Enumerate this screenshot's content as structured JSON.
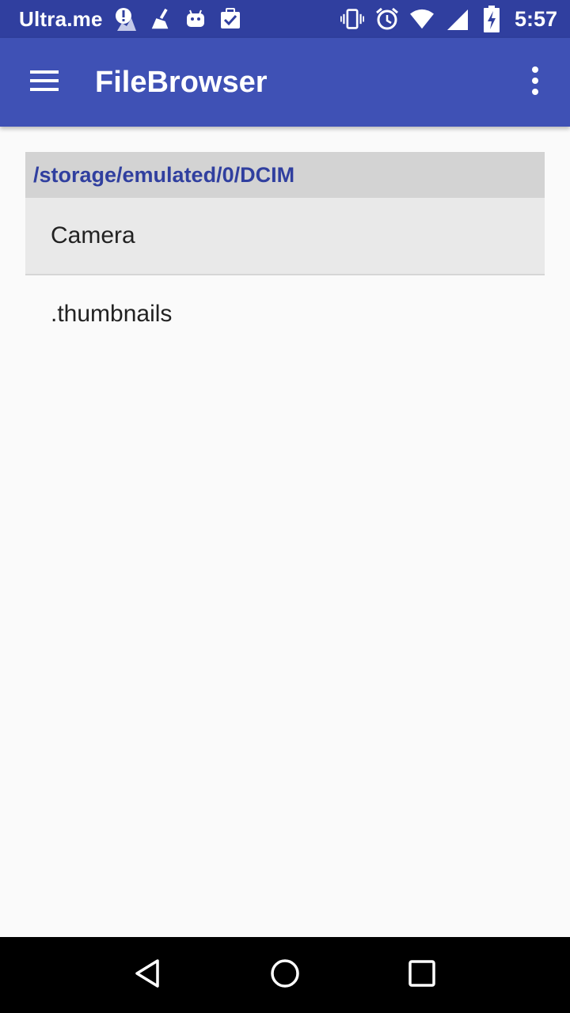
{
  "status_bar": {
    "carrier": "Ultra.me",
    "time": "5:57",
    "left_icons": [
      "alert-icon",
      "broom-icon",
      "android-icon",
      "clipboard-check-icon"
    ],
    "right_icons": [
      "vibrate-icon",
      "alarm-icon",
      "wifi-icon",
      "signal-icon",
      "battery-charging-icon"
    ]
  },
  "app_bar": {
    "title": "FileBrowser",
    "menu_icon": "hamburger-menu-icon",
    "overflow_icon": "more-vert-icon"
  },
  "browser": {
    "path": "/storage/emulated/0/DCIM",
    "items": [
      {
        "label": "Camera",
        "selected": true
      },
      {
        "label": ".thumbnails",
        "selected": false
      }
    ]
  },
  "nav_bar": {
    "buttons": [
      "back-icon",
      "home-icon",
      "recents-icon"
    ]
  },
  "colors": {
    "status_bar": "#303f9f",
    "app_bar": "#3f51b5",
    "path_text": "#303f9f",
    "path_bg": "#d3d3d3",
    "selected_bg": "#e9e9e9",
    "background": "#fafafa"
  }
}
